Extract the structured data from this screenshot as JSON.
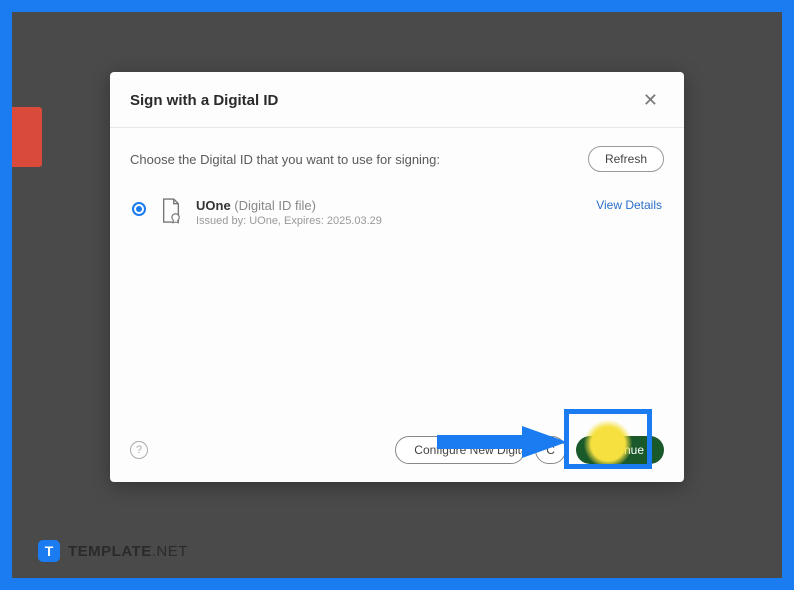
{
  "dialog": {
    "title": "Sign with a Digital ID",
    "close_glyph": "✕",
    "prompt": "Choose the Digital ID that you want to use for signing:",
    "refresh_label": "Refresh",
    "id_item": {
      "name": "UOne",
      "type": "(Digital ID file)",
      "issuer_line": "Issued by: UOne, Expires: 2025.03.29"
    },
    "view_details": "View Details",
    "help_glyph": "?",
    "configure_label": "Configure New Digital ID",
    "middle_btn_visible": "C",
    "continue_label": "Continue"
  },
  "watermark": {
    "icon_letter": "T",
    "brand": "TEMPLATE",
    "suffix": ".NET"
  }
}
